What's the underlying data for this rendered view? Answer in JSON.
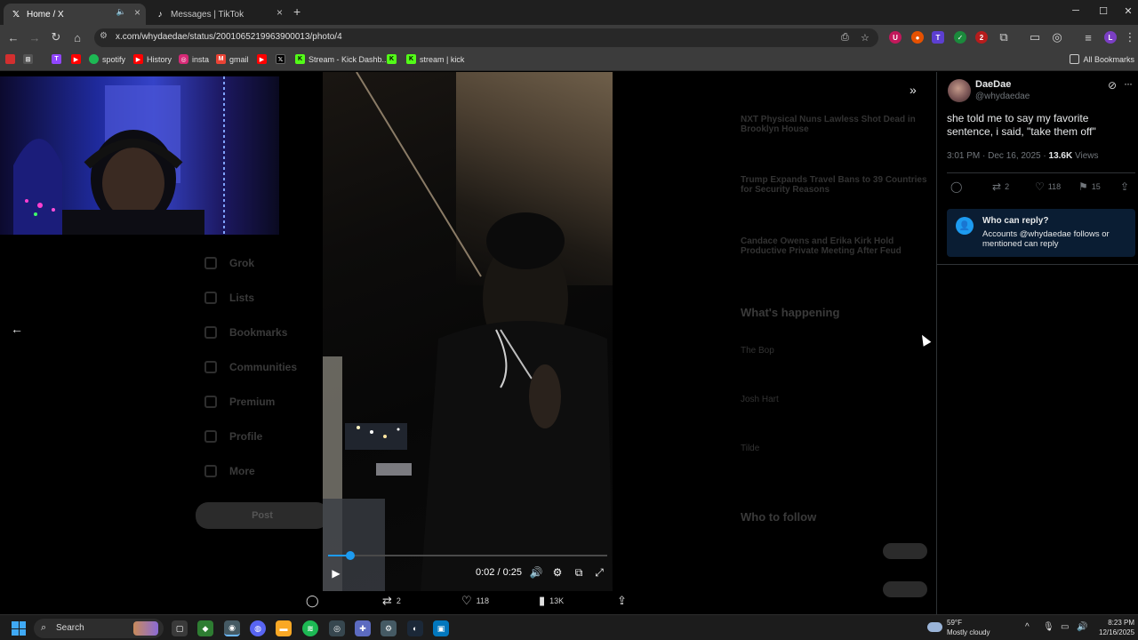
{
  "browser": {
    "tabs": [
      {
        "title": "Home / X",
        "favicon": "x-logo-icon",
        "active": true,
        "muted_icon": "speaker-icon"
      },
      {
        "title": "Messages | TikTok",
        "favicon": "tiktok-icon",
        "active": false
      }
    ],
    "new_tab_label": "+",
    "window_controls": {
      "minimize": "─",
      "maximize": "☐",
      "close": "✕"
    },
    "url": "x.com/whydaedae/status/2001065219963900013/photo/4",
    "bookmarks": [
      {
        "label": "",
        "icon": "twitch-icon",
        "color": "#9146ff"
      },
      {
        "label": "",
        "icon": "youtube-icon",
        "color": "#ff0000"
      },
      {
        "label": "spotify",
        "icon": "spotify-icon",
        "color": "#1db954"
      },
      {
        "label": "History",
        "icon": "youtube-icon",
        "color": "#ff0000"
      },
      {
        "label": "insta",
        "icon": "instagram-icon",
        "color": "#d62976"
      },
      {
        "label": "gmail",
        "icon": "gmail-icon",
        "color": "#ea4335"
      },
      {
        "label": "",
        "icon": "youtube-icon",
        "color": "#ff0000"
      },
      {
        "label": "",
        "icon": "x-logo-icon",
        "color": "#000000"
      },
      {
        "label": "Stream - Kick Dashb...",
        "icon": "kick-icon",
        "color": "#53fc18"
      },
      {
        "label": "",
        "icon": "kick-icon",
        "color": "#53fc18"
      },
      {
        "label": "stream | kick",
        "icon": "kick-icon",
        "color": "#53fc18"
      }
    ],
    "all_bookmarks_label": "All Bookmarks"
  },
  "background_page": {
    "sidebar_items": [
      "Grok",
      "Lists",
      "Bookmarks",
      "Communities",
      "Premium",
      "Profile",
      "More"
    ],
    "post_button": "Post",
    "trends": [
      "NXT Physical Nuns Lawless Shot Dead in Brooklyn House",
      "Trump Expands Travel Bans to 39 Countries for Security Reasons",
      "Candace Owens and Erika Kirk Hold Productive Private Meeting After Feud"
    ],
    "whats_happening_title": "What's happening",
    "happening_items": [
      "The Bop",
      "Josh Hart",
      "Tilde"
    ],
    "who_to_follow_title": "Who to follow"
  },
  "video": {
    "current_time": "0:02",
    "duration": "0:25",
    "time_display": "0:02 / 0:25",
    "progress": 0.08,
    "accent_color": "#1d9bf0"
  },
  "media_actions": {
    "reply_count": "",
    "retweet_count": "2",
    "like_count": "118",
    "views_count": "13K"
  },
  "tweet": {
    "display_name": "DaeDae",
    "handle": "@whydaedae",
    "text": "she told me to say my favorite sentence, i said, \"take them off\"",
    "time": "3:01 PM · Dec 16, 2025 · ",
    "views": "13.6K",
    "views_label": " Views",
    "actions": {
      "reply": "",
      "retweet": "2",
      "like": "118",
      "bookmark": "15"
    },
    "reply_restriction": {
      "title": "Who can reply?",
      "description": "Accounts @whydaedae follows or mentioned can reply"
    }
  },
  "taskbar": {
    "search_label": "Search",
    "weather_temp": "59°F",
    "weather_desc": "Mostly cloudy",
    "time": "8:23 PM",
    "date": "12/16/2025"
  }
}
